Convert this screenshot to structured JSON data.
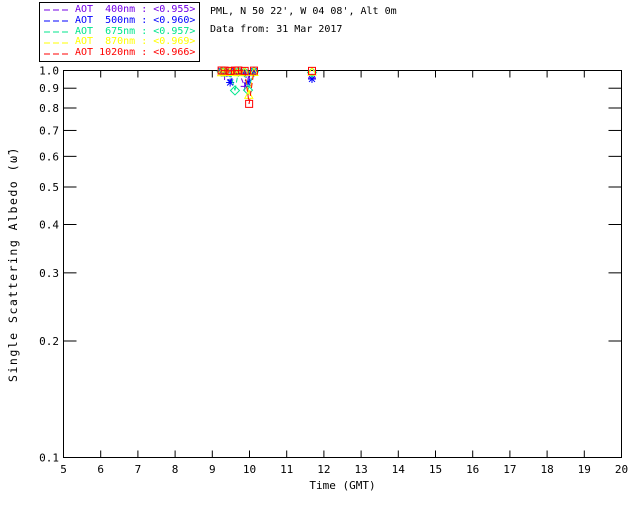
{
  "header": {
    "title": "PML, N 50 22', W 04 08', Alt 0m",
    "subtitle": "Data from: 31 Mar 2017"
  },
  "colors": {
    "background": "#ffffff",
    "axis": "#000000"
  },
  "chart_data": {
    "type": "scatter",
    "title": "PML, N 50 22', W 04 08', Alt 0m",
    "subtitle": "Data from: 31 Mar 2017",
    "xlabel": "Time (GMT)",
    "ylabel": "Single Scattering Albedo (ω̃)",
    "xlim": [
      5,
      20
    ],
    "ylim": [
      0.1,
      1.0
    ],
    "yscale": "log",
    "grid": false,
    "legend_position": "top-left-outside",
    "xticks": [
      5,
      6,
      7,
      8,
      9,
      10,
      11,
      12,
      13,
      14,
      15,
      16,
      17,
      18,
      19,
      20
    ],
    "xtick_labels": [
      "5",
      "6",
      "7",
      "8",
      "9",
      "10",
      "11",
      "12",
      "13",
      "14",
      "15",
      "16",
      "17",
      "18",
      "19",
      "20"
    ],
    "yticks": [
      1.0,
      0.9,
      0.8,
      0.7,
      0.6,
      0.5,
      0.4,
      0.3,
      0.2,
      0.1
    ],
    "ytick_labels": [
      "1.0",
      "0.9",
      "0.8",
      "0.7",
      "0.6",
      "0.5",
      "0.4",
      "0.3",
      "0.2",
      "0.1"
    ],
    "series": [
      {
        "name": "AOT 400nm",
        "legend_label": "AOT  400nm : <0.955>",
        "mean_value": "<0.955>",
        "color": "#7300e6",
        "marker": "plus",
        "linestyle": "dashed",
        "points": [
          [
            9.25,
            0.999
          ],
          [
            9.33,
            0.968
          ],
          [
            9.48,
            0.997
          ],
          [
            9.61,
            0.998
          ],
          [
            9.7,
            0.997
          ],
          [
            9.87,
            0.91
          ],
          [
            9.99,
            0.97
          ],
          [
            10.12,
            0.998
          ],
          [
            11.68,
            0.957
          ]
        ]
      },
      {
        "name": "AOT 500nm",
        "legend_label": "AOT  500nm : <0.960>",
        "mean_value": "<0.960>",
        "color": "#0000ff",
        "marker": "asterisk",
        "linestyle": "dashed",
        "points": [
          [
            9.25,
            0.997
          ],
          [
            9.33,
            0.99
          ],
          [
            9.48,
            0.931
          ],
          [
            9.61,
            0.996
          ],
          [
            9.7,
            0.995
          ],
          [
            9.87,
            0.985
          ],
          [
            9.96,
            0.928
          ],
          [
            10.12,
            0.996
          ],
          [
            11.68,
            0.951
          ]
        ]
      },
      {
        "name": "AOT 675nm",
        "legend_label": "AOT  675nm : <0.957>",
        "mean_value": "<0.957>",
        "color": "#00e68c",
        "marker": "diamond",
        "linestyle": "dashed",
        "points": [
          [
            9.25,
            0.993
          ],
          [
            9.33,
            0.991
          ],
          [
            9.48,
            0.989
          ],
          [
            9.61,
            0.888
          ],
          [
            9.7,
            0.992
          ],
          [
            9.87,
            0.99
          ],
          [
            9.96,
            0.89
          ],
          [
            10.12,
            0.993
          ],
          [
            11.68,
            0.988
          ]
        ]
      },
      {
        "name": "AOT 870nm",
        "legend_label": "AOT  870nm : <0.969>",
        "mean_value": "<0.969>",
        "color": "#ffff00",
        "marker": "triangle",
        "linestyle": "dashed",
        "points": [
          [
            9.25,
            0.99
          ],
          [
            9.33,
            0.993
          ],
          [
            9.48,
            0.991
          ],
          [
            9.61,
            0.992
          ],
          [
            9.7,
            0.99
          ],
          [
            9.87,
            0.992
          ],
          [
            9.98,
            0.865
          ],
          [
            10.12,
            0.991
          ],
          [
            11.68,
            0.993
          ]
        ]
      },
      {
        "name": "AOT 1020nm",
        "legend_label": "AOT 1020nm : <0.966>",
        "mean_value": "<0.966>",
        "color": "#ff0000",
        "marker": "square",
        "linestyle": "dashed",
        "points": [
          [
            9.25,
            1.0
          ],
          [
            9.33,
            0.999
          ],
          [
            9.48,
            0.998
          ],
          [
            9.61,
            0.999
          ],
          [
            9.7,
            1.0
          ],
          [
            9.87,
            0.998
          ],
          [
            9.99,
            0.82
          ],
          [
            10.12,
            0.999
          ],
          [
            11.68,
            0.998
          ]
        ]
      }
    ]
  }
}
